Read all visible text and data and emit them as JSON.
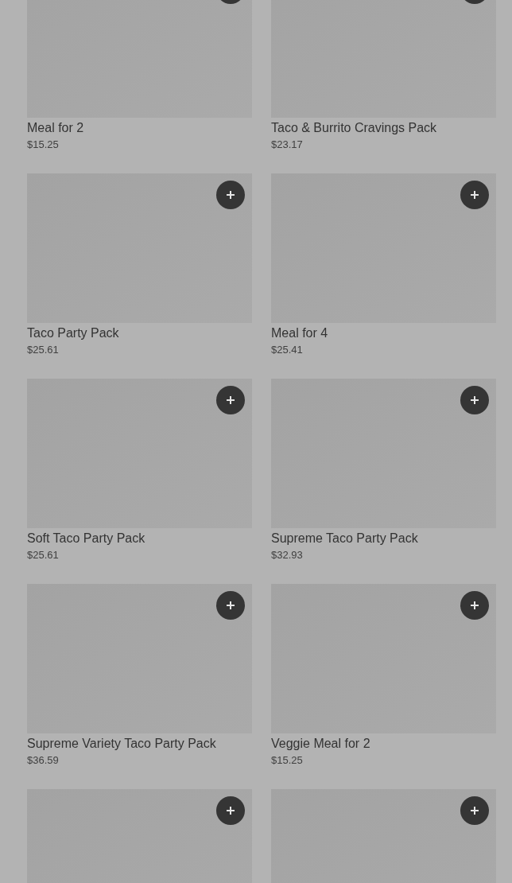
{
  "products": [
    {
      "kind": "product",
      "name": "Meal for 2",
      "price": "$15.25"
    },
    {
      "kind": "product",
      "name": "Taco & Burrito Cravings Pack",
      "price": "$23.17"
    },
    {
      "kind": "product",
      "name": "Taco Party Pack",
      "price": "$25.61"
    },
    {
      "kind": "product",
      "name": "Meal for 4",
      "price": "$25.41"
    },
    {
      "kind": "product",
      "name": "Soft Taco Party Pack",
      "price": "$25.61"
    },
    {
      "kind": "product",
      "name": "Supreme Taco Party Pack",
      "price": "$32.93"
    },
    {
      "kind": "product",
      "name": "Supreme Variety Taco Party Pack",
      "price": "$36.59"
    },
    {
      "kind": "product",
      "name": "Veggie Meal for 2",
      "price": "$15.25"
    },
    {
      "kind": "image-only"
    },
    {
      "kind": "image-only"
    }
  ]
}
